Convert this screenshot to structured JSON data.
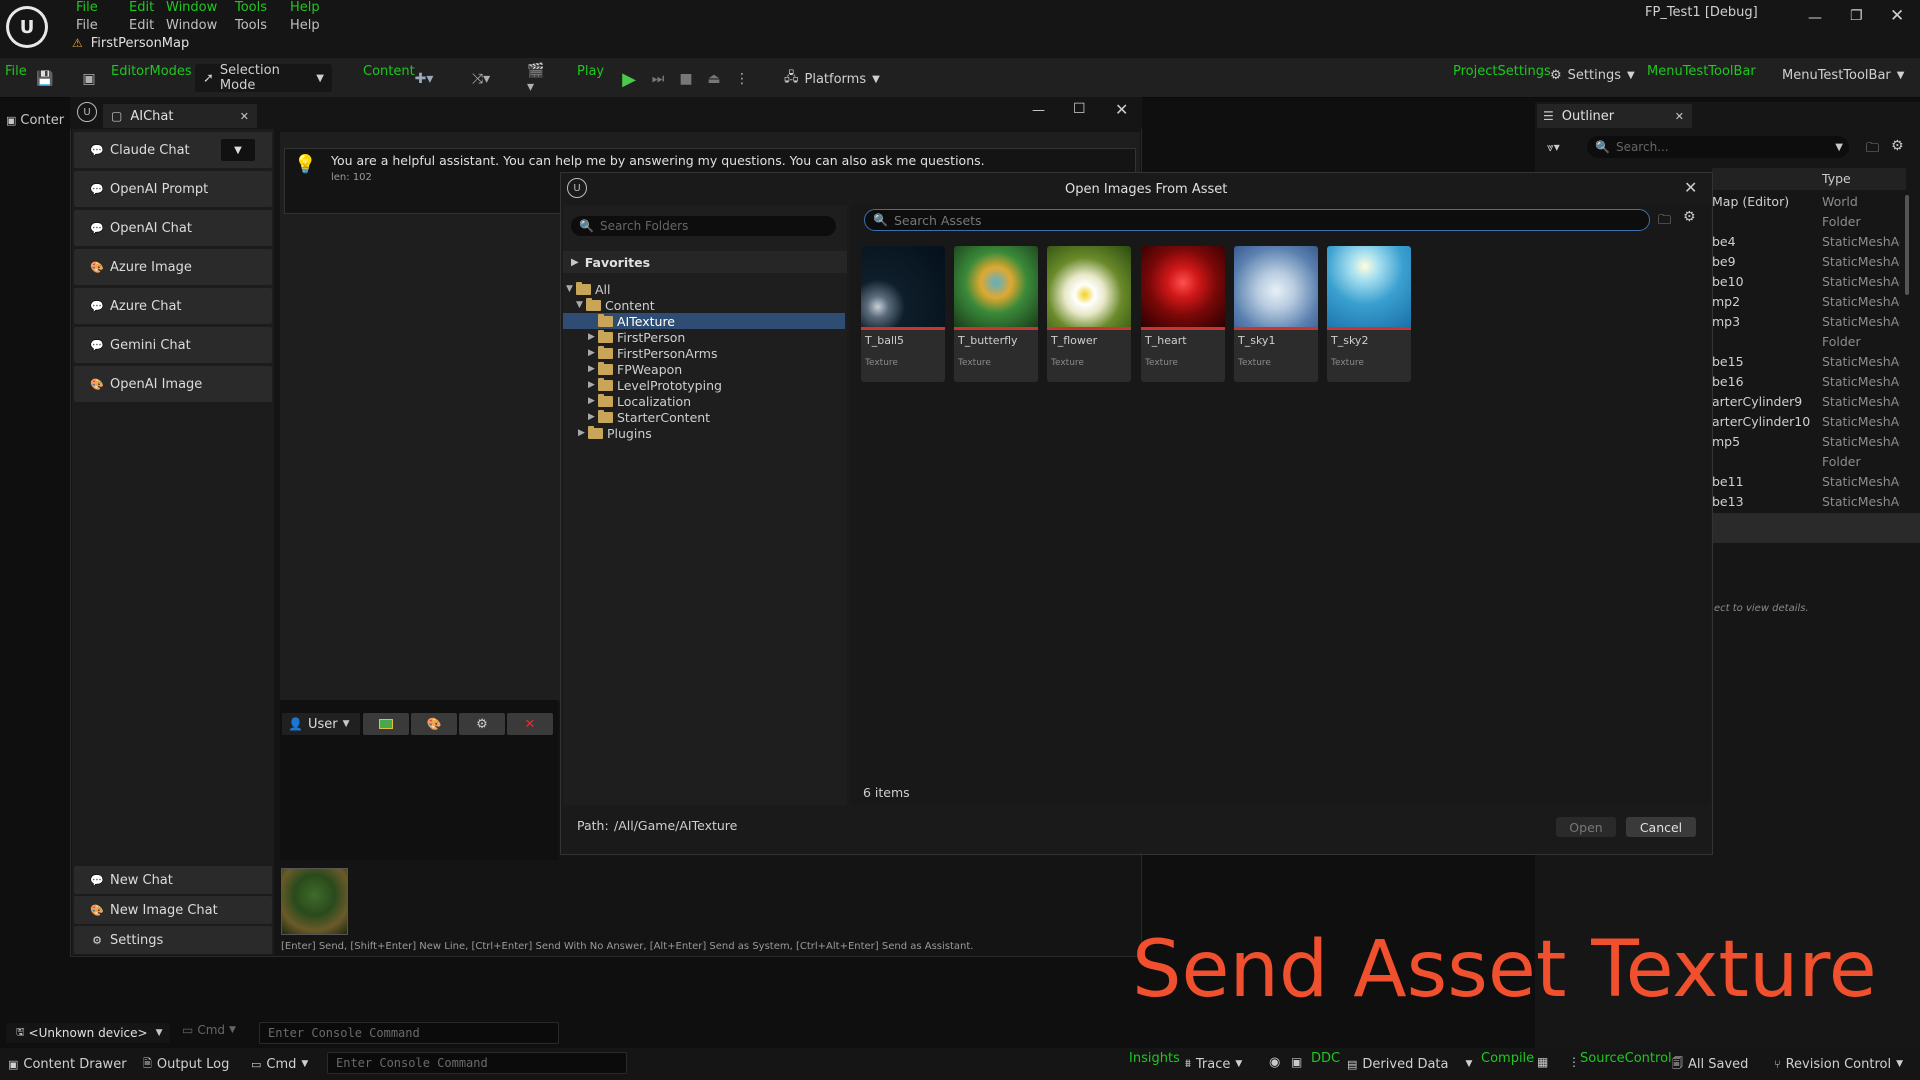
{
  "title_bar": {
    "project": "FP_Test1 [Debug]",
    "menu_green": [
      "File",
      "Edit",
      "Window",
      "Tools",
      "Help"
    ],
    "menu_grey": [
      "File",
      "Edit",
      "Window",
      "Tools",
      "Help"
    ],
    "map_name": "FirstPersonMap"
  },
  "toolbar": {
    "file": "File",
    "editor_modes": "EditorModes",
    "selection_mode": "Selection Mode",
    "content": "Content",
    "play": "Play",
    "platforms": "Platforms",
    "project_settings": "ProjectSettings",
    "settings": "Settings",
    "menu_test_toolbar_green": "MenuTestToolBar",
    "menu_test_toolbar": "MenuTestToolBar"
  },
  "left_tab": {
    "label": "Conter"
  },
  "aichat": {
    "tab_label": "AIChat",
    "sidebar": [
      {
        "label": "Claude Chat",
        "icon": "chat-icon"
      },
      {
        "label": "OpenAI Prompt",
        "icon": "chat-icon"
      },
      {
        "label": "OpenAI Chat",
        "icon": "chat-icon"
      },
      {
        "label": "Azure Image",
        "icon": "palette-icon"
      },
      {
        "label": "Azure Chat",
        "icon": "chat-icon"
      },
      {
        "label": "Gemini Chat",
        "icon": "chat-icon"
      },
      {
        "label": "OpenAI Image",
        "icon": "palette-icon"
      }
    ],
    "bottom_buttons": [
      {
        "label": "New Chat",
        "icon": "chat-icon"
      },
      {
        "label": "New Image Chat",
        "icon": "palette-icon"
      },
      {
        "label": "Settings",
        "icon": "gear-icon"
      }
    ],
    "system_message": "You are a helpful assistant. You can help me by answering my questions. You can also ask me questions.",
    "system_len": "len: 102",
    "role_label": "User",
    "hint": "[Enter] Send, [Shift+Enter] New Line, [Ctrl+Enter] Send With No Answer, [Alt+Enter] Send as System, [Ctrl+Alt+Enter] Send as Assistant."
  },
  "dialog": {
    "title": "Open Images From Asset",
    "search_folders_placeholder": "Search Folders",
    "search_assets_placeholder": "Search Assets",
    "favorites": "Favorites",
    "tree": {
      "all": "All",
      "content": "Content",
      "selected": "AITexture",
      "children": [
        "FirstPerson",
        "FirstPersonArms",
        "FPWeapon",
        "LevelPrototyping",
        "Localization",
        "StarterContent"
      ],
      "plugins": "Plugins"
    },
    "assets": [
      {
        "name": "T_ball5",
        "type": "Texture"
      },
      {
        "name": "T_butterfly",
        "type": "Texture"
      },
      {
        "name": "T_flower",
        "type": "Texture"
      },
      {
        "name": "T_heart",
        "type": "Texture"
      },
      {
        "name": "T_sky1",
        "type": "Texture"
      },
      {
        "name": "T_sky2",
        "type": "Texture"
      }
    ],
    "item_count": "6 items",
    "path_label": "Path:",
    "path_value": "/All/Game/AITexture",
    "open": "Open",
    "cancel": "Cancel"
  },
  "outliner": {
    "tab_label": "Outliner",
    "search_placeholder": "Search...",
    "type_header": "Type",
    "rows": [
      {
        "name": "Map (Editor)",
        "type": "World"
      },
      {
        "name": "",
        "type": "Folder"
      },
      {
        "name": "be4",
        "type": "StaticMeshAc"
      },
      {
        "name": "be9",
        "type": "StaticMeshAc"
      },
      {
        "name": "be10",
        "type": "StaticMeshAc"
      },
      {
        "name": "mp2",
        "type": "StaticMeshAc"
      },
      {
        "name": "mp3",
        "type": "StaticMeshAc"
      },
      {
        "name": "",
        "type": "Folder"
      },
      {
        "name": "be15",
        "type": "StaticMeshAc"
      },
      {
        "name": "be16",
        "type": "StaticMeshAc"
      },
      {
        "name": "arterCylinder9",
        "type": "StaticMeshAc"
      },
      {
        "name": "arterCylinder10",
        "type": "StaticMeshAc"
      },
      {
        "name": "mp5",
        "type": "StaticMeshAc"
      },
      {
        "name": "",
        "type": "Folder"
      },
      {
        "name": "be11",
        "type": "StaticMeshAc"
      },
      {
        "name": "be13",
        "type": "StaticMeshAc"
      }
    ],
    "details_hint": "ect to view details."
  },
  "console_row": {
    "device": "<Unknown device>",
    "cmd": "Cmd",
    "placeholder": "Enter Console Command"
  },
  "status_bar": {
    "content_drawer": "Content Drawer",
    "output_log": "Output Log",
    "cmd": "Cmd",
    "console_placeholder": "Enter Console Command",
    "insights": "Insights",
    "trace": "Trace",
    "ddc": "DDC",
    "derived_data": "Derived Data",
    "compile": "Compile",
    "source_control": "SourceControl",
    "all_saved": "All Saved",
    "revision_control": "Revision Control"
  },
  "overlay_caption": "Send Asset Texture",
  "colors": {
    "green": "#1ec81e",
    "caption": "#f0502d",
    "selected": "#2f4d73"
  }
}
